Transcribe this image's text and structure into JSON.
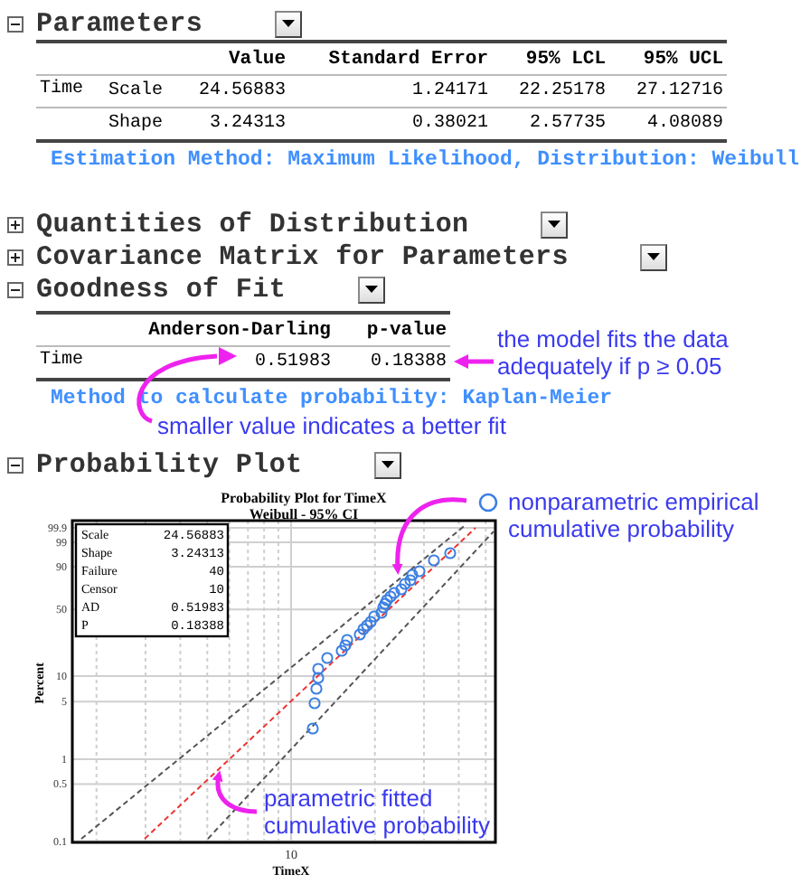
{
  "sections": [
    {
      "kind": "table",
      "title": "Parameters",
      "expanded": true,
      "table": {
        "columns": [
          "Value",
          "Standard Error",
          "95% LCL",
          "95% UCL"
        ],
        "rows": [
          {
            "group": "Time",
            "label": "Scale",
            "values": [
              "24.56883",
              "1.24171",
              "22.25178",
              "27.12716"
            ]
          },
          {
            "label": "Shape",
            "values": [
              "3.24313",
              "0.38021",
              "2.57735",
              "4.08089"
            ]
          }
        ]
      },
      "note": "Estimation Method: Maximum Likelihood, Distribution: Weibull"
    },
    {
      "kind": "collapsed",
      "title": "Quantities of Distribution",
      "expanded": false
    },
    {
      "kind": "collapsed",
      "title": "Covariance Matrix for Parameters",
      "expanded": false
    },
    {
      "kind": "table",
      "title": "Goodness of Fit",
      "expanded": true,
      "table": {
        "columns": [
          "Anderson-Darling",
          "p-value"
        ],
        "rows": [
          {
            "group": "Time",
            "values": [
              "0.51983",
              "0.18388"
            ]
          }
        ]
      },
      "note": "Method to calculate probability: Kaplan-Meier",
      "callouts": [
        {
          "kind": "side",
          "text": "the model fits the data adequately if p ≥ 0.05"
        },
        {
          "kind": "below",
          "text": "smaller value indicates a better fit"
        }
      ]
    },
    {
      "kind": "plot",
      "title": "Probability Plot",
      "expanded": true,
      "plot": {
        "title": "Probability Plot for TimeX",
        "subtitle": "Weibull - 95% CI",
        "xlabel": "TimeX",
        "ylabel": "Percent",
        "xticks": [
          "10"
        ],
        "yticks": [
          "99.9",
          "99",
          "90",
          "50",
          "10",
          "5",
          "1",
          "0.5",
          "0.1"
        ],
        "stats": [
          {
            "label": "Scale",
            "value": "24.56883"
          },
          {
            "label": "Shape",
            "value": "3.24313"
          },
          {
            "label": "Failure",
            "value": "40"
          },
          {
            "label": "Censor",
            "value": "10"
          },
          {
            "label": "AD",
            "value": "0.51983"
          },
          {
            "label": "P",
            "value": "0.18388"
          }
        ],
        "callouts": [
          {
            "kind": "legend",
            "text": "nonparametric empirical cumulative probability"
          },
          {
            "kind": "fit",
            "text": "parametric fitted cumulative probability"
          }
        ]
      }
    }
  ]
}
